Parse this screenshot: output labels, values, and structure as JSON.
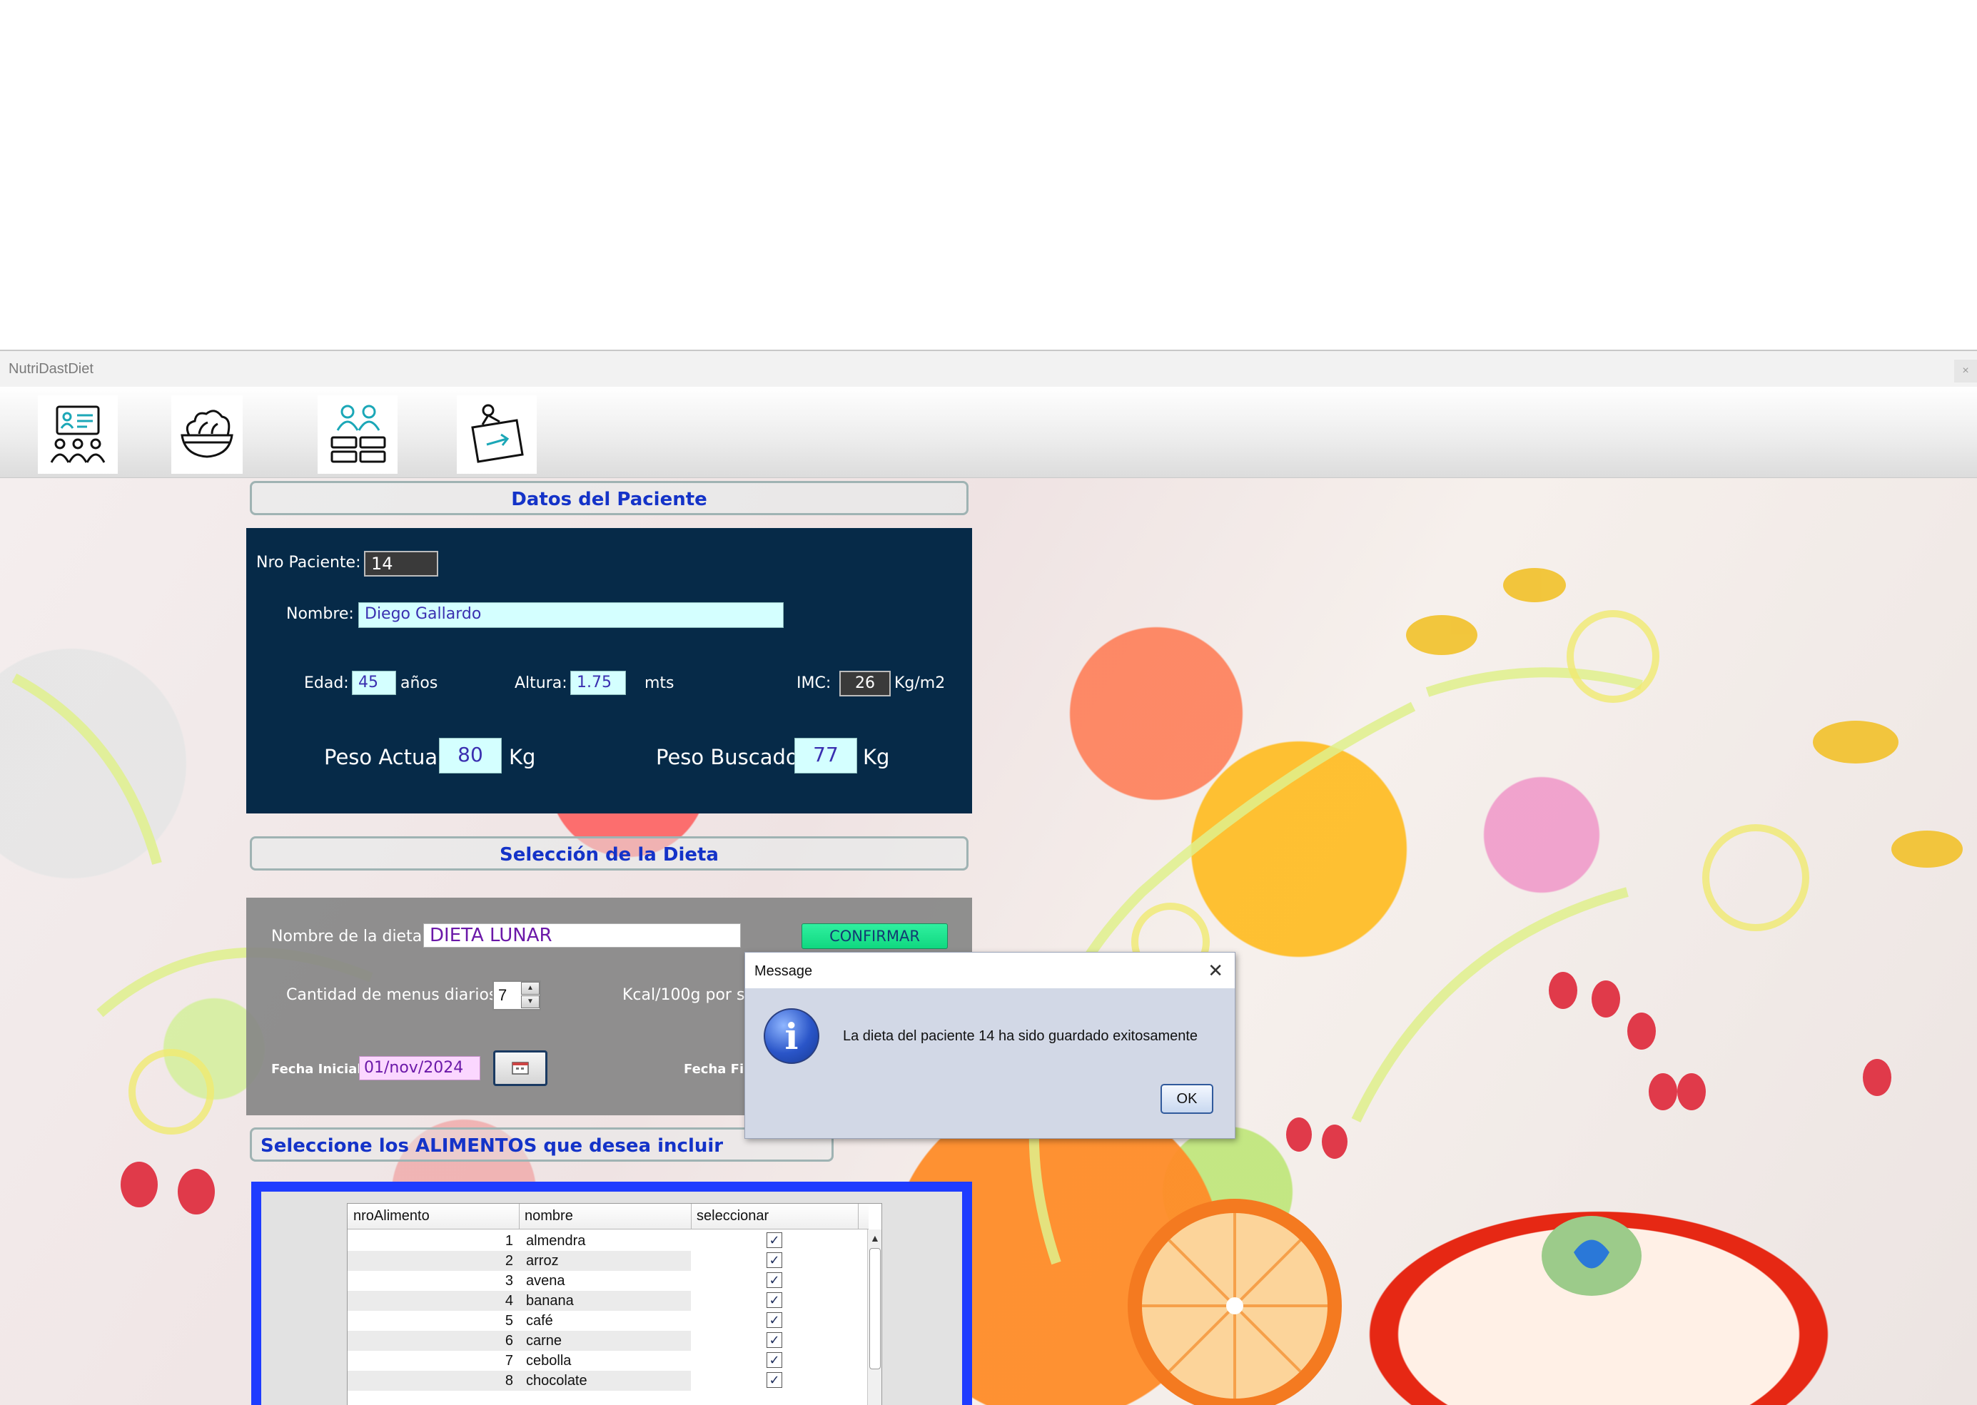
{
  "window": {
    "title": "NutriDastDiet",
    "close_label": "×"
  },
  "toolbar": {
    "items": [
      {
        "name": "patients"
      },
      {
        "name": "foods"
      },
      {
        "name": "groups"
      },
      {
        "name": "exit"
      }
    ]
  },
  "patient": {
    "section_title": "Datos del Paciente",
    "nro_label": "Nro Paciente:",
    "nro_value": "14",
    "nombre_label": "Nombre:",
    "nombre_value": "Diego Gallardo",
    "edad_label": "Edad:",
    "edad_value": "45",
    "edad_unit": "años",
    "altura_label": "Altura:",
    "altura_value": "1.75",
    "altura_unit": "mts",
    "imc_label": "IMC:",
    "imc_value": "26",
    "imc_unit": "Kg/m2",
    "peso_actual_label": "Peso Actual:",
    "peso_actual_value": "80",
    "peso_actual_unit": "Kg",
    "peso_buscado_label": "Peso Buscado:",
    "peso_buscado_value": "77",
    "peso_buscado_unit": "Kg"
  },
  "diet": {
    "section_title": "Selección de la Dieta",
    "nombre_label": "Nombre de la dieta:",
    "nombre_value": "DIETA LUNAR",
    "confirm_label": "CONFIRMAR",
    "menus_label": "Cantidad de menus diarios:",
    "menus_value": "7",
    "kcal_label": "Kcal/100g por se",
    "fecha_inicial_label": "Fecha Inicial:",
    "fecha_inicial_value": "01/nov/2024",
    "fecha_final_label": "Fecha Fin"
  },
  "foods": {
    "section_title": "Seleccione los ALIMENTOS que desea incluir",
    "columns": [
      "nroAlimento",
      "nombre",
      "seleccionar"
    ],
    "rows": [
      {
        "nro": "1",
        "nombre": "almendra",
        "selected": "✓"
      },
      {
        "nro": "2",
        "nombre": "arroz",
        "selected": "✓"
      },
      {
        "nro": "3",
        "nombre": "avena",
        "selected": "✓"
      },
      {
        "nro": "4",
        "nombre": "banana",
        "selected": "✓"
      },
      {
        "nro": "5",
        "nombre": "café",
        "selected": "✓"
      },
      {
        "nro": "6",
        "nombre": "carne",
        "selected": "✓"
      },
      {
        "nro": "7",
        "nombre": "cebolla",
        "selected": "✓"
      },
      {
        "nro": "8",
        "nombre": "chocolate",
        "selected": "✓"
      }
    ]
  },
  "dialog": {
    "title": "Message",
    "close_label": "✕",
    "message": "La dieta del paciente 14 ha sido guardado exitosamente",
    "ok_label": "OK",
    "icon_glyph": "i"
  }
}
